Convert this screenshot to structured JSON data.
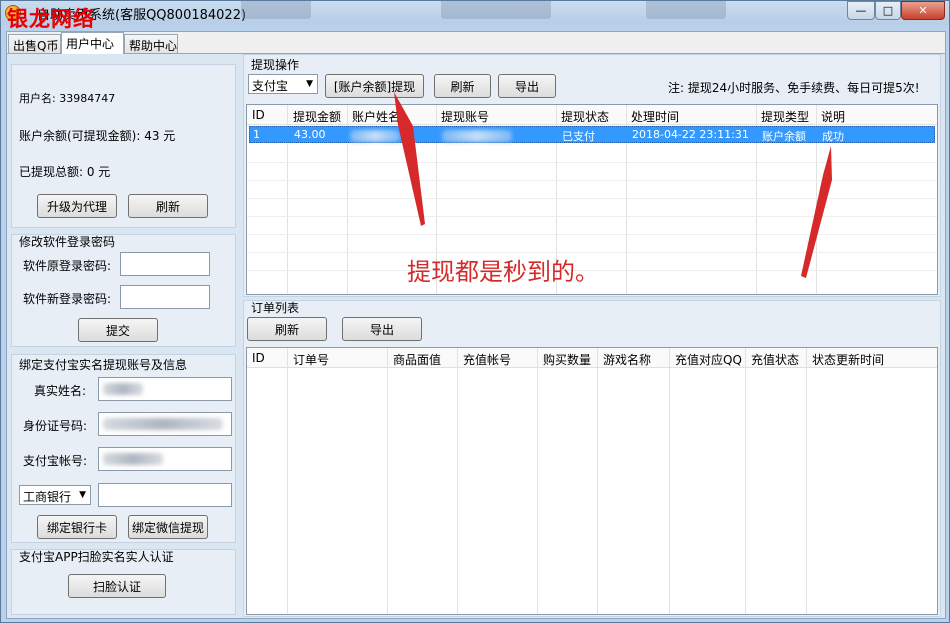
{
  "window": {
    "title": "自助卖币系统(客服QQ800184022)",
    "brand": "银龙网络",
    "buttons": {
      "minimize": "—",
      "maximize": "□",
      "close": "✕"
    }
  },
  "tabs": [
    {
      "label": "出售Q币"
    },
    {
      "label": "用户中心"
    },
    {
      "label": "帮助中心"
    }
  ],
  "user_info": {
    "username": "用户名: 33984747",
    "balance": "账户余额(可提现金额): 43 元",
    "withdrawn": "已提现总额: 0 元",
    "upgrade_button": "升级为代理",
    "refresh_button": "刷新"
  },
  "password_panel": {
    "title": "修改软件登录密码",
    "old_label": "软件原登录密码:",
    "new_label": "软件新登录密码:",
    "submit_button": "提交"
  },
  "bind_panel": {
    "title": "绑定支付宝实名提现账号及信息",
    "name_label": "真实姓名:",
    "id_label": "身份证号码:",
    "alipay_label": "支付宝帐号:",
    "bank_select": "工商银行",
    "bind_card_button": "绑定银行卡",
    "bind_wechat_button": "绑定微信提现"
  },
  "face_panel": {
    "title": "支付宝APP扫脸实名实人认证",
    "face_button": "扫脸认证"
  },
  "withdraw": {
    "title": "提现操作",
    "method_select": "支付宝",
    "withdraw_button": "[账户余额]提现",
    "refresh_button": "刷新",
    "export_button": "导出",
    "notice": "注: 提现24小时服务、免手续费、每日可提5次!",
    "columns": [
      "ID",
      "提现金额",
      "账户姓名",
      "提现账号",
      "提现状态",
      "处理时间",
      "提现类型",
      "说明"
    ],
    "rows": [
      {
        "id": "1",
        "amount": "43.00",
        "name": "",
        "account": "",
        "status": "已支付",
        "time": "2018-04-22 23:11:31",
        "type": "账户余额",
        "desc": "成功"
      }
    ],
    "annotation": "提现都是秒到的。"
  },
  "orders": {
    "title": "订单列表",
    "refresh_button": "刷新",
    "export_button": "导出",
    "columns": [
      "ID",
      "订单号",
      "商品面值",
      "充值帐号",
      "购买数量",
      "游戏名称",
      "充值对应QQ",
      "充值状态",
      "状态更新时间"
    ]
  },
  "colors": {
    "selection": "#3399ff",
    "annotation_red": "#d62a2a",
    "brand_red": "#e80000"
  }
}
